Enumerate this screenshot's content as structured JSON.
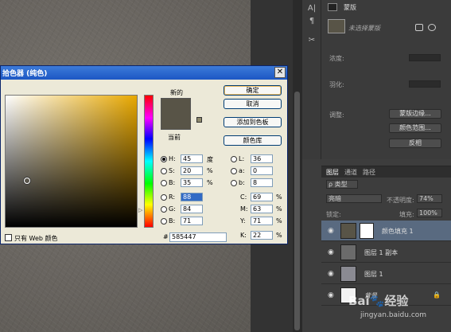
{
  "dialog": {
    "title": "拾色器 (纯色)",
    "buttons": {
      "ok": "确定",
      "cancel": "取消",
      "add_swatch": "添加到色板",
      "color_library": "颜色库"
    },
    "labels": {
      "new": "新的",
      "current": "当前",
      "web_only": "只有 Web 颜色",
      "hex_sign": "#"
    },
    "color_hex": "#585447",
    "hsb": {
      "h": {
        "label": "H:",
        "value": "45",
        "unit": "度"
      },
      "s": {
        "label": "S:",
        "value": "20",
        "unit": "%"
      },
      "b": {
        "label": "B:",
        "value": "35",
        "unit": "%"
      }
    },
    "rgb": {
      "r": {
        "label": "R:",
        "value": "88"
      },
      "g": {
        "label": "G:",
        "value": "84"
      },
      "b": {
        "label": "B:",
        "value": "71"
      }
    },
    "lab": {
      "l": {
        "label": "L:",
        "value": "36"
      },
      "a": {
        "label": "a:",
        "value": "0"
      },
      "b": {
        "label": "b:",
        "value": "8"
      }
    },
    "cmyk": {
      "c": {
        "label": "C:",
        "value": "69",
        "unit": "%"
      },
      "m": {
        "label": "M:",
        "value": "63",
        "unit": "%"
      },
      "y": {
        "label": "Y:",
        "value": "71",
        "unit": "%"
      },
      "k": {
        "label": "K:",
        "value": "22",
        "unit": "%"
      }
    },
    "hex_value": "585447"
  },
  "properties": {
    "title": "蒙版",
    "mask_label": "未选择蒙版",
    "density_label": "浓度:",
    "feather_label": "羽化:",
    "adjust_label": "调整:",
    "mask_edge_btn": "蒙版边缘...",
    "color_range_btn": "颜色范围...",
    "invert_btn": "反相"
  },
  "layers": {
    "tabs": [
      "图层",
      "通道",
      "路径"
    ],
    "filter_label": "ρ 类型",
    "blend_mode": "亮暗",
    "opacity_label": "不透明度:",
    "opacity_value": "74%",
    "lock_label": "锁定:",
    "fill_label": "填充:",
    "fill_value": "100%",
    "items": [
      {
        "name": "颜色填充 1",
        "selected": true,
        "thumb_color": "#585447"
      },
      {
        "name": "图层 1 副本",
        "selected": false,
        "thumb_color": "#6b6b6b"
      },
      {
        "name": "图层 1",
        "selected": false,
        "thumb_color": "#8a8a92"
      },
      {
        "name": "背景",
        "selected": false,
        "thumb_color": "#f2f2f2"
      }
    ]
  },
  "watermark": {
    "brand": "Bai🐾经验",
    "url": "jingyan.baidu.com"
  }
}
